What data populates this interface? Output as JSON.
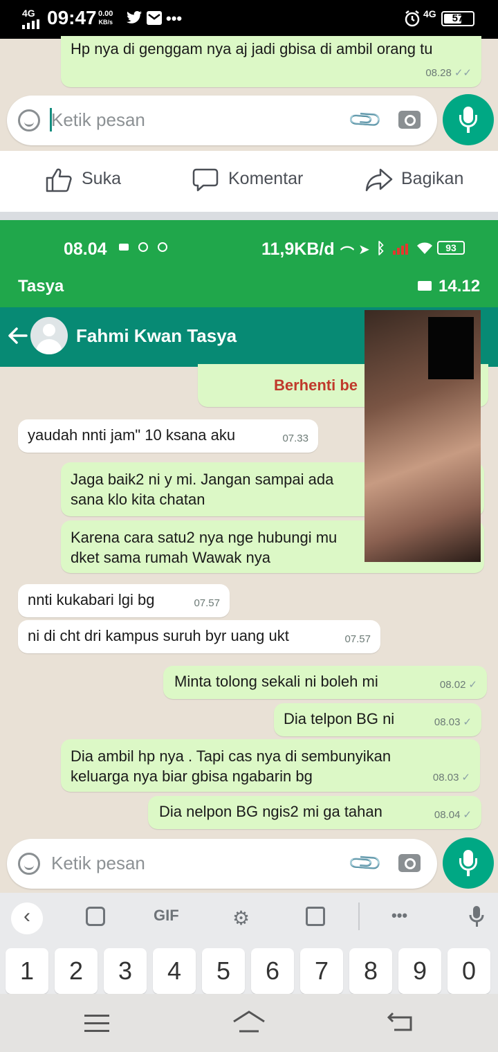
{
  "status_top": {
    "network": "4G",
    "time": "09:47",
    "speed_value": "0.00",
    "speed_unit": "KB/s",
    "more": "•••",
    "right_network": "4G",
    "battery": "57"
  },
  "chat_top": {
    "message": {
      "text": "Hp nya di genggam nya aj jadi gbisa di ambil orang tu",
      "time": "08.28",
      "tick": "✓✓"
    },
    "input_placeholder": "Ketik pesan"
  },
  "fb_actions": {
    "like": "Suka",
    "comment": "Komentar",
    "share": "Bagikan"
  },
  "status_second": {
    "time": "08.04",
    "speed": "11,9KB/d",
    "battery": "93",
    "call_name": "Tasya",
    "call_duration": "14.12"
  },
  "chat_header": {
    "name": "Fahmi Kwan Tasya"
  },
  "messages": [
    {
      "text": "Berhenti be"
    },
    {
      "text": "yaudah nnti jam\" 10 ksana aku",
      "time": "07.33"
    },
    {
      "text": "Jaga baik2 ni y mi. Jangan sampai ada sana klo kita chatan"
    },
    {
      "text": "Karena cara satu2 nya nge hubungi mu dket sama rumah Wawak nya"
    },
    {
      "text": "nnti kukabari lgi bg",
      "time": "07.57"
    },
    {
      "text": "ni di cht dri kampus suruh byr uang ukt",
      "time": "07.57"
    },
    {
      "text": "Minta tolong sekali ni boleh mi",
      "time": "08.02",
      "tick": "✓"
    },
    {
      "text": "Dia telpon BG ni",
      "time": "08.03",
      "tick": "✓"
    },
    {
      "text": "Dia ambil hp nya . Tapi cas nya di sembunyikan keluarga nya biar gbisa ngabarin bg",
      "time": "08.03",
      "tick": "✓"
    },
    {
      "text": "Dia nelpon BG ngis2 mi ga tahan",
      "time": "08.04",
      "tick": "✓"
    }
  ],
  "chat_bottom": {
    "input_placeholder": "Ketik pesan"
  },
  "keyboard": {
    "toolbar": {
      "back": "‹",
      "gif": "GIF",
      "more": "•••"
    },
    "digits": [
      "1",
      "2",
      "3",
      "4",
      "5",
      "6",
      "7",
      "8",
      "9",
      "0"
    ]
  }
}
